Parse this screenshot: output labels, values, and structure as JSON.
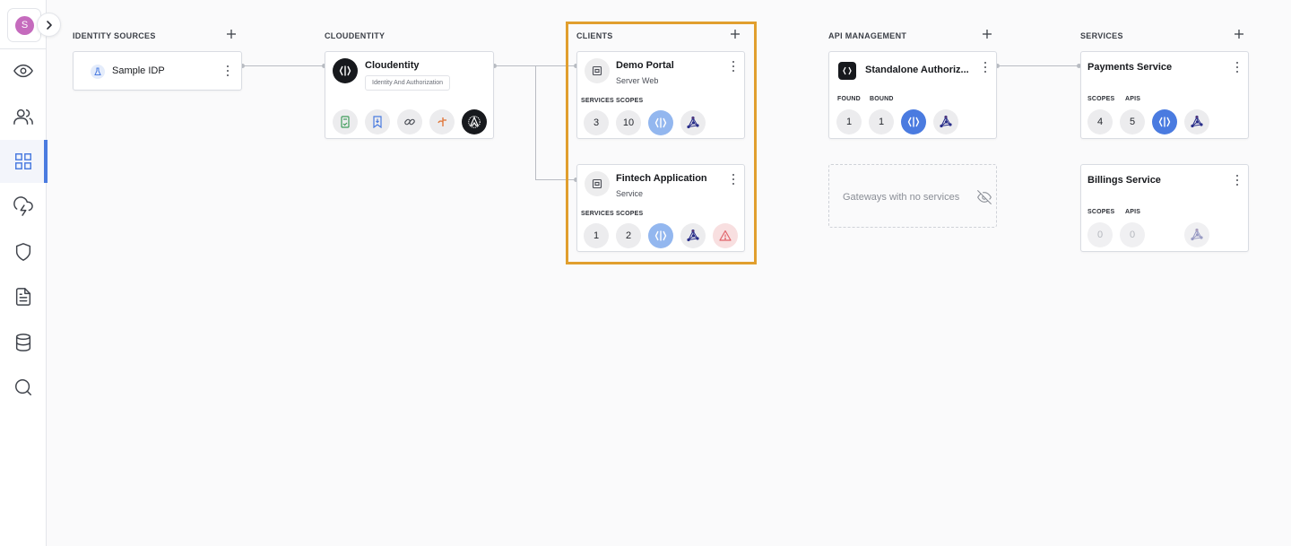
{
  "user": {
    "avatar_letter": "S",
    "avatar_color": "#c56bbd"
  },
  "sidebar": {
    "items": [
      {
        "icon": "eye-icon",
        "active": false
      },
      {
        "icon": "users-icon",
        "active": false
      },
      {
        "icon": "grid-icon",
        "active": true
      },
      {
        "icon": "cloud-lightning-icon",
        "active": false
      },
      {
        "icon": "shield-icon",
        "active": false
      },
      {
        "icon": "document-icon",
        "active": false
      },
      {
        "icon": "database-icon",
        "active": false
      },
      {
        "icon": "search-icon",
        "active": false
      }
    ]
  },
  "columns": {
    "identity_sources": {
      "title": "IDENTITY SOURCES",
      "cards": [
        {
          "name": "Sample IDP",
          "icon": "idp-icon"
        }
      ]
    },
    "cloudentity": {
      "title": "CLOUDENTITY",
      "card": {
        "name": "Cloudentity",
        "tag": "Identity And Authorization",
        "icons": [
          "document-check-icon",
          "bookmark-download-icon",
          "link-icon",
          "plugin-icon",
          "spaceship-badge-icon"
        ]
      }
    },
    "clients": {
      "title": "CLIENTS",
      "cards": [
        {
          "name": "Demo Portal",
          "type": "Server Web",
          "labels": [
            "SERVICES",
            "SCOPES"
          ],
          "values": [
            "3",
            "10"
          ]
        },
        {
          "name": "Fintech Application",
          "type": "Service",
          "labels": [
            "SERVICES",
            "SCOPES"
          ],
          "values": [
            "1",
            "2"
          ]
        }
      ]
    },
    "api_management": {
      "title": "API MANAGEMENT",
      "card": {
        "name": "Standalone Authoriz...",
        "labels": [
          "FOUND",
          "BOUND"
        ],
        "values": [
          "1",
          "1"
        ]
      },
      "empty_text": "Gateways with no services"
    },
    "services": {
      "title": "SERVICES",
      "cards": [
        {
          "name": "Payments Service",
          "labels": [
            "SCOPES",
            "APIS"
          ],
          "values": [
            "4",
            "5"
          ]
        },
        {
          "name": "Billings Service",
          "labels": [
            "SCOPES",
            "APIS"
          ],
          "values": [
            "0",
            "0"
          ]
        }
      ]
    }
  },
  "colors": {
    "accent_blue": "#4a7be0",
    "light_blue": "#93b7ef",
    "highlight_orange": "#e19f2e",
    "warning_red": "#e0646a"
  }
}
